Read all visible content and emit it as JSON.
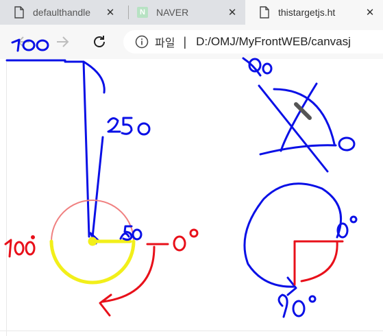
{
  "tabs": [
    {
      "title": "defaulthandle",
      "icon": "document-icon",
      "active": false
    },
    {
      "title": "NAVER",
      "icon": "naver-icon",
      "badge": "N",
      "active": false
    },
    {
      "title": "thistargetjs.ht",
      "icon": "document-icon",
      "active": true
    }
  ],
  "toolbar": {
    "back": "back-arrow-icon",
    "forward": "forward-arrow-icon",
    "reload": "reload-icon"
  },
  "address": {
    "scheme_label": "파일",
    "divider": "|",
    "url": "D:/OMJ/MyFrontWEB/canvasj"
  },
  "drawing": {
    "annotations": {
      "left_top": "100",
      "length": "250",
      "angle_90_top": "90",
      "angle_0_top": "0",
      "radius": "50",
      "angle_180": "180°",
      "angle_0": "0°",
      "angle_0_right": "0°",
      "angle_90_bottom": "90°"
    },
    "colors": {
      "blue_ink": "#0a10e6",
      "red_ink": "#e8101a",
      "yellow_ink": "#f2ef1a",
      "circle_red": "#f08080"
    }
  }
}
